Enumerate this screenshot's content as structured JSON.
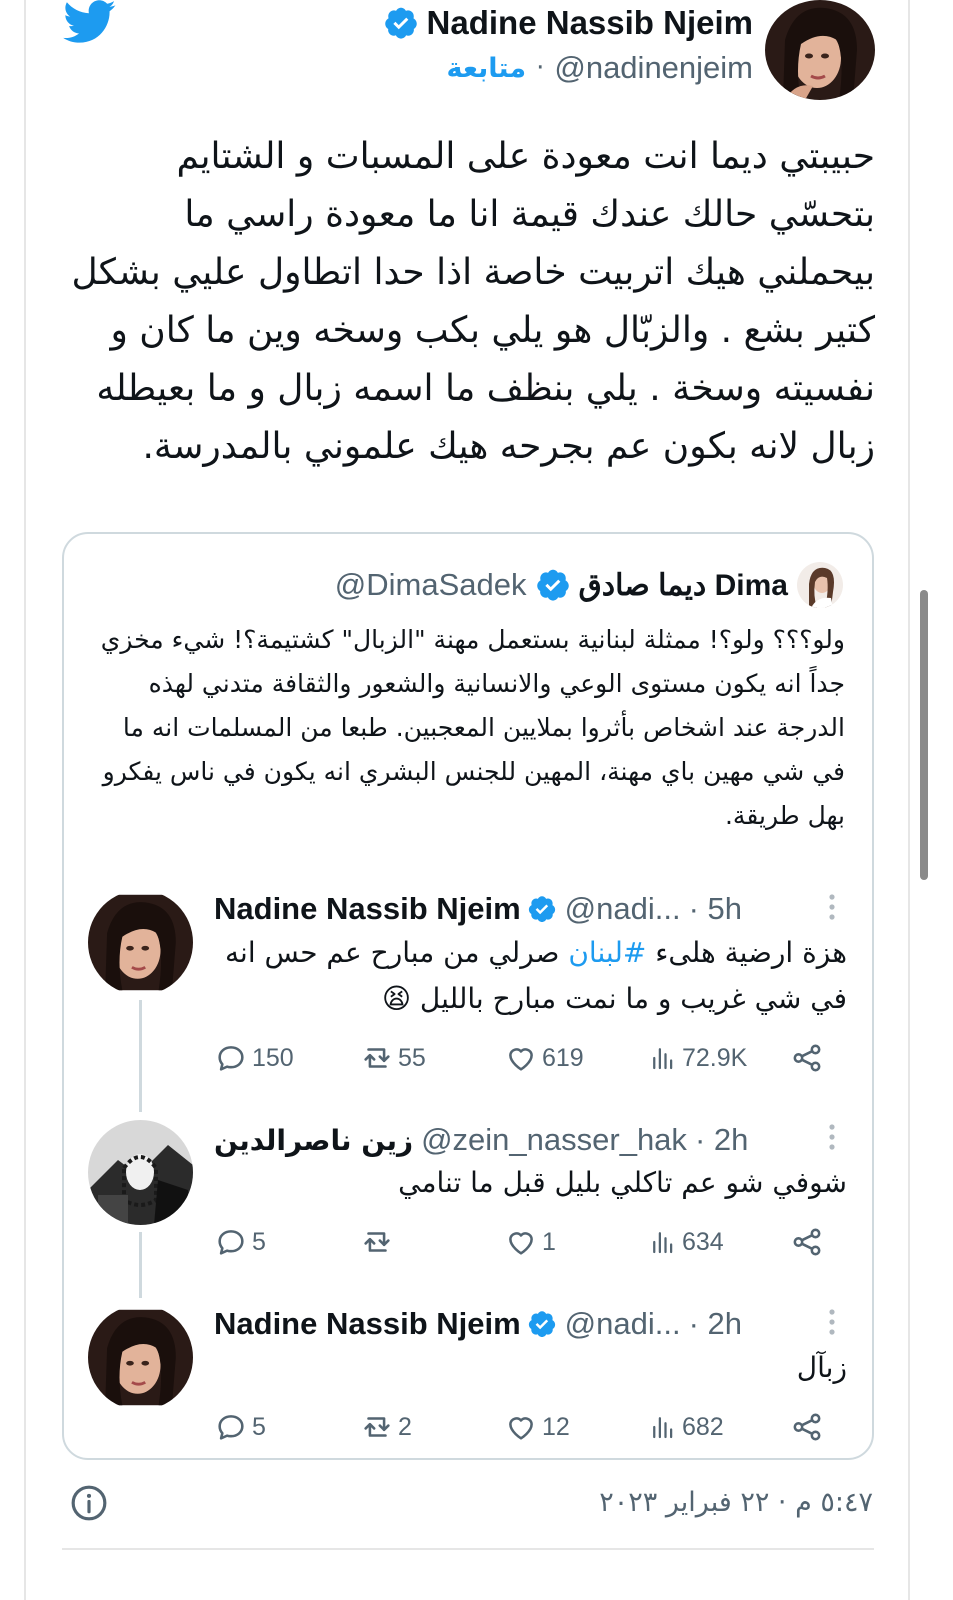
{
  "main_tweet": {
    "author_name": "Nadine Nassib Njeim",
    "handle": "@nadinenjeim",
    "follow_label": "متابعة",
    "separator": "·",
    "text": "حبيبتي ديما انت معودة على المسبات و الشتايم بتحسّي حالك عندك قيمة انا ما معودة راسي ما بيحملني هيك اتربيت خاصة اذا حدا اتطاول عليي بشكل كتير بشع . والزبّال هو يلي بكب وسخه وين ما كان و نفسيته وسخة . يلي بنظف ما اسمه زبال و ما بعيطله زبال لانه بكون عم بجرحه هيك علموني بالمدرسة."
  },
  "quoted_tweet": {
    "author_name": "ديما صادق Dima",
    "handle": "@DimaSadek",
    "text": "ولو؟؟؟ ولو؟! ممثلة لبنانية  بستعمل مهنة \"الزبال\" كشتيمة؟! شيء مخزي جداً انه يكون  مستوى الوعي والانسانية والشعور والثقافة متدني لهذه الدرجة عند اشخاص بأثروا بملايين المعجبين. طبعا من المسلمات انه ما في شي مهين باي مهنة، المهين للجنس البشري انه يكون في ناس يفكرو بهل طريقة."
  },
  "replies": [
    {
      "author_name": "Nadine Nassib Njeim",
      "handle": "@nadi...",
      "time": "· 5h",
      "text_before_hashtag": "هزة ارضية هلىء ",
      "hashtag": "#لبنان",
      "text_after_hashtag": " صرلي من مبارح عم حس انه في شي غريب و ما نمت مبارح بالليل 😫",
      "stats": {
        "replies": "150",
        "retweets": "55",
        "likes": "619",
        "views": "72.9K"
      }
    },
    {
      "author_name": "زين ناصرالدين",
      "handle": "@zein_nasser_hak",
      "time": "· 2h",
      "text": "شوفي شو عم تاكلي بليل قبل ما تنامي",
      "stats": {
        "replies": "5",
        "retweets": "",
        "likes": "1",
        "views": "634"
      }
    },
    {
      "author_name": "Nadine Nassib Njeim",
      "handle": "@nadi...",
      "time": "· 2h",
      "text": "زبآل",
      "stats": {
        "replies": "5",
        "retweets": "2",
        "likes": "12",
        "views": "682"
      }
    }
  ],
  "footer": {
    "timestamp": "٥:٤٧ م · ٢٢ فبراير ٢٠٢٣"
  },
  "icons": {
    "logo": "twitter-bird-icon",
    "verified": "verified-badge-icon",
    "reply": "reply-icon",
    "retweet": "retweet-icon",
    "like": "heart-icon",
    "views": "views-icon",
    "share": "share-icon",
    "more": "more-icon",
    "info": "info-icon"
  },
  "colors": {
    "accent": "#1d9bf0",
    "text": "#0f1419",
    "muted": "#536471",
    "border": "#cfd9de"
  }
}
